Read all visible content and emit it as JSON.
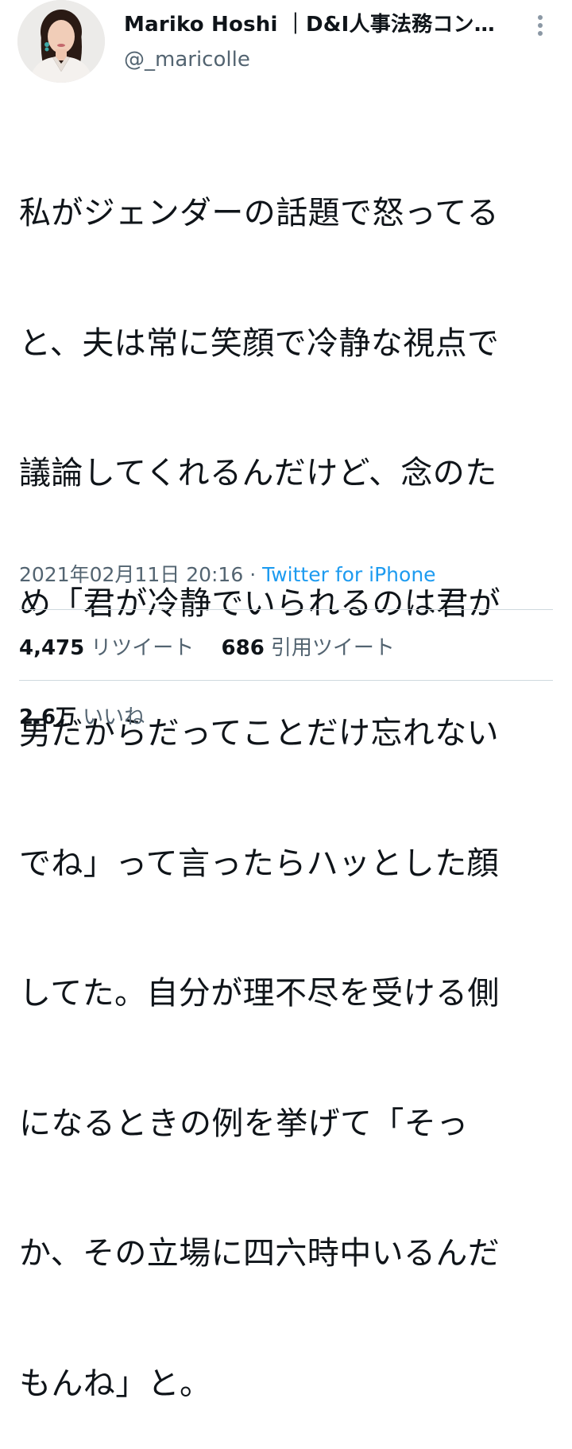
{
  "tweet": {
    "author": {
      "display_name": "Mariko Hoshi ｜D&I人事法務コン…",
      "handle": "@_maricolle"
    },
    "text_lines": [
      "私がジェンダーの話題で怒ってる",
      "と、夫は常に笑顔で冷静な視点で",
      "議論してくれるんだけど、念のた",
      "め「君が冷静でいられるのは君が",
      "男だからだってことだけ忘れない",
      "でね」って言ったらハッとした顔",
      "してた。自分が理不尽を受ける側",
      "になるときの例を挙げて「そっ",
      "か、その立場に四六時中いるんだ",
      "もんね」と。"
    ],
    "timestamp": "2021年02月11日 20:16",
    "separator": " · ",
    "source": "Twitter for iPhone",
    "stats": {
      "retweets": {
        "count": "4,475",
        "label": "リツイート"
      },
      "quotes": {
        "count": "686",
        "label": "引用ツイート"
      },
      "likes": {
        "count": "2.6万",
        "label": "いいね"
      }
    }
  },
  "icons": {
    "more": "more-vertical-icon"
  },
  "colors": {
    "text": "#0f1419",
    "secondary": "#536471",
    "link": "#1d9bf0",
    "divider": "#cfd9de"
  }
}
